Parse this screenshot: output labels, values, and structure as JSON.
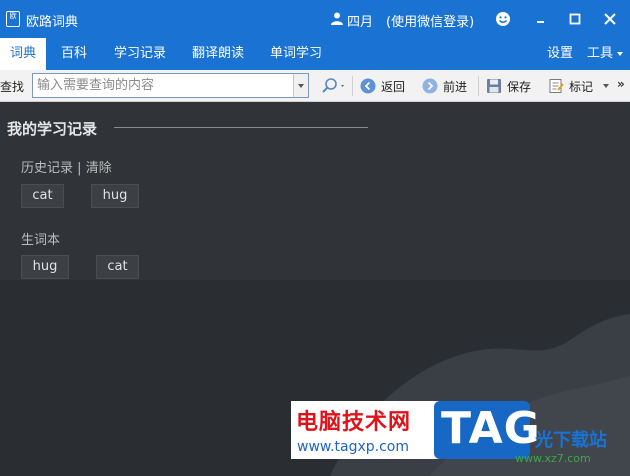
{
  "titlebar": {
    "app_icon_text": "欧",
    "title": "欧路词典",
    "user_name": "四月",
    "login_hint": "(使用微信登录)"
  },
  "nav": {
    "tabs": [
      {
        "label": "词典",
        "active": true
      },
      {
        "label": "百科",
        "active": false
      },
      {
        "label": "学习记录",
        "active": false
      },
      {
        "label": "翻译朗读",
        "active": false
      },
      {
        "label": "单词学习",
        "active": false
      }
    ],
    "settings_label": "设置",
    "tools_label": "工具"
  },
  "toolbar": {
    "find_label": "查找",
    "search_placeholder": "输入需要查询的内容",
    "back_label": "返回",
    "forward_label": "前进",
    "save_label": "保存",
    "mark_label": "标记",
    "more_label": "»"
  },
  "records": {
    "title": "我的学习记录",
    "history_label": "历史记录",
    "divider": "|",
    "clear_label": "清除",
    "history_items": [
      "cat",
      "hug"
    ],
    "vocab_label": "生词本",
    "vocab_items": [
      "hug",
      "cat"
    ]
  },
  "watermark": {
    "site_name": "电脑技术网",
    "site_url": "www.tagxp.com",
    "tag_text": "TAG",
    "right_text": "光下载站",
    "right_url": "www.xz7.com"
  },
  "colors": {
    "brand_blue": "#1a73d3",
    "content_bg": "#303338"
  }
}
